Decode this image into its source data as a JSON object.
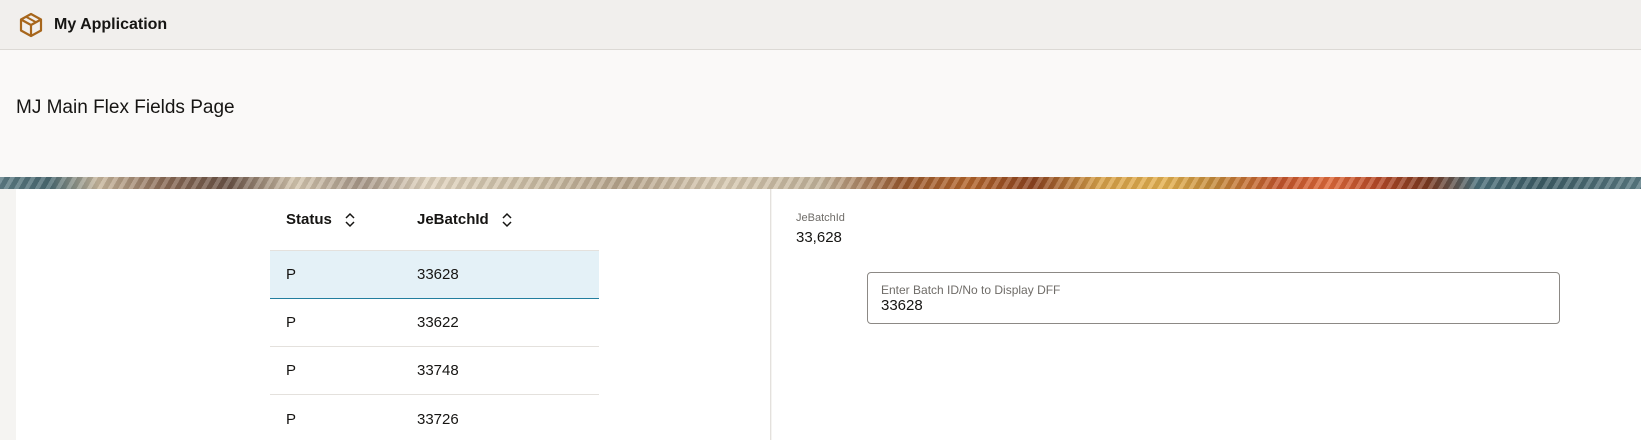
{
  "app": {
    "title": "My Application",
    "logo_icon": "cube-icon"
  },
  "page": {
    "title": "MJ Main Flex Fields Page"
  },
  "table": {
    "columns": [
      {
        "label": "Status",
        "sort_icon": "sort-updown-icon"
      },
      {
        "label": "JeBatchId",
        "sort_icon": "sort-updown-icon"
      }
    ],
    "rows": [
      {
        "status": "P",
        "je_batch_id": "33628",
        "selected": true
      },
      {
        "status": "P",
        "je_batch_id": "33622",
        "selected": false
      },
      {
        "status": "P",
        "je_batch_id": "33748",
        "selected": false
      },
      {
        "status": "P",
        "je_batch_id": "33726",
        "selected": false
      }
    ]
  },
  "detail": {
    "readonly_label": "JeBatchId",
    "readonly_value": "33,628",
    "input": {
      "label": "Enter Batch ID/No to Display DFF",
      "value": "33628"
    }
  },
  "colors": {
    "accent": "#227e9e",
    "selected_row": "#e4f1f7",
    "logo": "#a7661c"
  }
}
